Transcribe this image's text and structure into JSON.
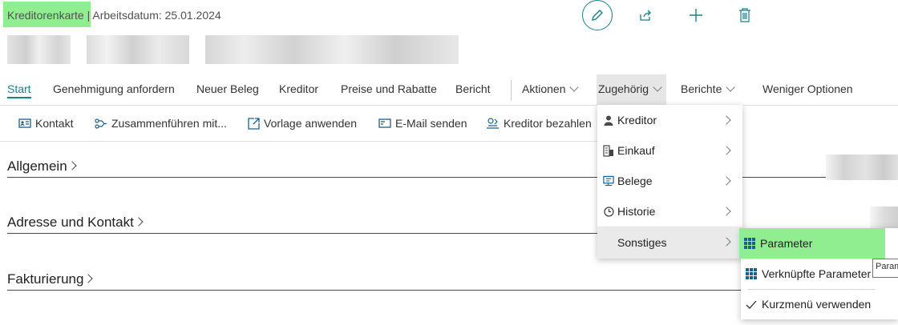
{
  "header": {
    "page_name": "Kreditorenkarte",
    "separator": "|",
    "work_date": "Arbeitsdatum: 25.01.2024"
  },
  "tabs": [
    {
      "label": "Start",
      "active": true
    },
    {
      "label": "Genehmigung anfordern"
    },
    {
      "label": "Neuer Beleg"
    },
    {
      "label": "Kreditor"
    },
    {
      "label": "Preise und Rabatte"
    },
    {
      "label": "Bericht"
    },
    {
      "label": "Aktionen",
      "dropdown": true
    },
    {
      "label": "Zugehörig",
      "dropdown": true,
      "open": true
    },
    {
      "label": "Berichte",
      "dropdown": true
    },
    {
      "label": "Weniger Optionen"
    }
  ],
  "subbar": [
    {
      "label": "Kontakt",
      "icon": "contact-card-icon"
    },
    {
      "label": "Zusammenführen mit...",
      "icon": "merge-icon"
    },
    {
      "label": "Vorlage anwenden",
      "icon": "template-icon"
    },
    {
      "label": "E-Mail senden",
      "icon": "email-icon"
    },
    {
      "label": "Kreditor bezahlen",
      "icon": "pay-icon"
    }
  ],
  "sections": [
    "Allgemein",
    "Adresse und Kontakt",
    "Fakturierung"
  ],
  "menu": [
    {
      "label": "Kreditor",
      "icon": "person-icon"
    },
    {
      "label": "Einkauf",
      "icon": "purchase-icon"
    },
    {
      "label": "Belege",
      "icon": "documents-icon"
    },
    {
      "label": "Historie",
      "icon": "history-icon"
    },
    {
      "label": "Sonstiges",
      "icon": "",
      "highlighted": true
    }
  ],
  "submenu": [
    {
      "label": "Parameter",
      "icon": "grid-icon",
      "highlighted": true
    },
    {
      "label": "Verknüpfte Parameter",
      "icon": "grid-icon"
    },
    {
      "label": "Kurzmenü verwenden",
      "icon": "checkmark-icon"
    }
  ],
  "tooltip": "Parameter",
  "colors": {
    "accent": "#1d7f87",
    "highlight": "#90ee90",
    "menu_hover": "#eaeaea"
  }
}
